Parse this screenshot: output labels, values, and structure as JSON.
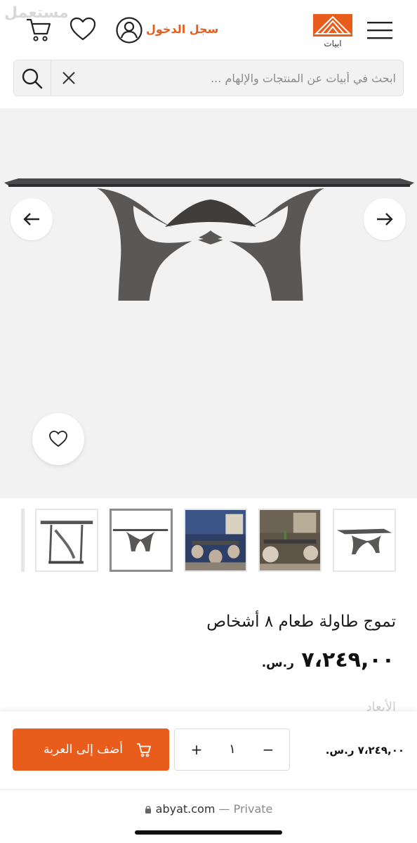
{
  "header": {
    "watermark": "مستعمل",
    "login_label": "سجل الدخول",
    "logo_text": "ابيات",
    "accent": "#e85c1c"
  },
  "search": {
    "placeholder": "ابحث في أبيات عن المنتجات والإلهام ..."
  },
  "gallery": {
    "thumbnails": [
      "table-side-view",
      "table-front-view",
      "dining-room-scene-1",
      "dining-room-scene-2",
      "table-angle-view"
    ],
    "active_thumbnail": 1
  },
  "product": {
    "title": "تموج طاولة طعام ٨ أشخاص",
    "price_value": "٧،٢٤٩,٠٠",
    "currency": "ر.س.",
    "peek": "الأبعاد"
  },
  "cart_bar": {
    "add_label": "أضف إلى العربة",
    "plus": "+",
    "minus": "−",
    "quantity": "١",
    "price": "٧،٢٤٩,٠٠ ر.س."
  },
  "browser": {
    "domain": "abyat.com",
    "separator": " — ",
    "mode": "Private"
  }
}
